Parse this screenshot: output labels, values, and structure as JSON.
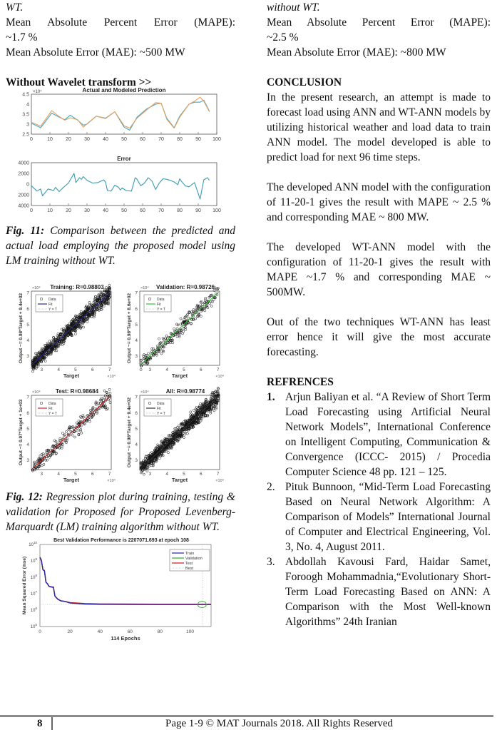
{
  "left": {
    "intro_tail": "WT.",
    "mape_line": "Mean Absolute Percent Error (MAPE):",
    "mape_value": "~1.7 %",
    "mae_line": "Mean Absolute Error (MAE): ~500 MW",
    "section_heading": "Without Wavelet transform >>",
    "fig11": {
      "label": "Fig. 11:",
      "text": " Comparison between the predicted and actual load employing the proposed model using LM training without WT."
    },
    "fig12": {
      "label": "Fig. 12:",
      "text": " Regression plot during training, testing & validation for Proposed for Proposed Levenberg-Marquardt (LM) training algorithm without WT."
    }
  },
  "right": {
    "intro_tail": "without WT.",
    "mape_line": "Mean Absolute Percent Error (MAPE):",
    "mape_value": "~2.5 %",
    "mae_line": "Mean Absolute Error (MAE): ~800 MW",
    "conclusion_heading": "CONCLUSION",
    "paragraphs": [
      "In the present research, an attempt is made to forecast load using ANN and WT-ANN models by utilizing historical weather and load data to train ANN model. The model developed is able to predict load for next 96 time steps.",
      "The developed ANN model with the configuration of 11-20-1 gives the result with MAPE ~ 2.5 % and corresponding MAE ~ 800 MW.",
      "The developed WT-ANN model with the configuration of 11-20-1 gives the result with MAPE ~1.7 % and corresponding MAE ~ 500MW.",
      "Out of the two techniques WT-ANN has least error hence it will give the most accurate forecasting."
    ],
    "references_heading": "REFRENCES",
    "references": [
      {
        "num": "1.",
        "text": "Arjun Baliyan et al. “A Review of Short Term Load Forecasting using Artificial Neural Network Models”, International Conference on Intelligent Computing, Communication & Convergence (ICCC- 2015) / Procedia Computer Science 48 pp. 121 – 125."
      },
      {
        "num": "2.",
        "text": "Pituk Bunnoon, “Mid-Term Load Forecasting Based on Neural Network Algorithm: A Comparison of Models” International Journal of Computer and Electrical Engineering, Vol. 3, No. 4, August 2011."
      },
      {
        "num": "3.",
        "text": "Abdollah Kavousi Fard, Haidar Samet, Foroogh Mohammadnia,“Evolutionary Short-Term Load Forecasting Based on ANN: A Comparison with the Most Well-known Algorithms” 24th Iranian"
      }
    ]
  },
  "footer": {
    "page_number": "8",
    "copyright": "Page 1-9 © MAT Journals 2018. All Rights Reserved"
  },
  "chart_data": [
    {
      "type": "line",
      "title": "Actual and Modeled Prediction",
      "exponent_label": "×10⁴",
      "xlim": [
        0,
        100
      ],
      "ylim": [
        2.5,
        4.5
      ],
      "xticks": [
        0,
        10,
        20,
        30,
        40,
        50,
        60,
        70,
        80,
        90,
        100
      ],
      "yticks": [
        2.5,
        3,
        3.5,
        4,
        4.5
      ],
      "x": [
        0,
        5,
        11,
        15,
        18,
        21,
        25,
        28,
        30,
        35,
        40,
        45,
        50,
        53,
        57,
        62,
        67,
        70,
        73,
        77,
        80,
        85,
        88,
        91,
        93,
        96
      ],
      "series": [
        {
          "name": "Actual",
          "color": "#3ea6c9",
          "values": [
            3.05,
            2.82,
            3.55,
            3.35,
            3.22,
            3.45,
            3.2,
            2.95,
            3.0,
            3.4,
            3.3,
            3.62,
            2.85,
            2.7,
            3.35,
            3.75,
            4.0,
            4.05,
            3.3,
            2.82,
            3.4,
            4.0,
            4.1,
            4.1,
            4.2,
            3.65
          ]
        },
        {
          "name": "Modeled",
          "color": "#e8a05a",
          "values": [
            3.1,
            2.9,
            3.68,
            3.38,
            3.2,
            3.32,
            3.22,
            2.85,
            3.02,
            3.4,
            3.28,
            3.62,
            2.92,
            2.8,
            3.3,
            3.7,
            4.08,
            4.05,
            3.25,
            2.8,
            3.35,
            4.0,
            4.15,
            4.35,
            4.15,
            3.62
          ]
        }
      ]
    },
    {
      "type": "line",
      "title": "Error",
      "xlim": [
        0,
        100
      ],
      "ylim": [
        -4000,
        4000
      ],
      "xticks": [
        0,
        10,
        20,
        30,
        40,
        50,
        60,
        70,
        80,
        90,
        100
      ],
      "yticks": [
        4000,
        2000,
        0,
        -2000,
        -4000
      ],
      "ytick_labels": [
        "4000",
        "2000",
        "0",
        "2000",
        "4000"
      ],
      "x": [
        0,
        3,
        5,
        6,
        9,
        12,
        13,
        15,
        17,
        20,
        23,
        24,
        26,
        27,
        28,
        30,
        33,
        36,
        39,
        40,
        41,
        43,
        45,
        47,
        48,
        49,
        51,
        54,
        56,
        57,
        59,
        61,
        63,
        65,
        67,
        69,
        71,
        73,
        75,
        77,
        79,
        80,
        81,
        83,
        85,
        88,
        91,
        93,
        95,
        96
      ],
      "series": [
        {
          "name": "Error",
          "color": "#3a9cb0",
          "values": [
            -300,
            -1300,
            -900,
            -2200,
            -900,
            -1200,
            -600,
            -1400,
            -700,
            200,
            2000,
            300,
            1200,
            900,
            1400,
            700,
            200,
            300,
            800,
            400,
            -1200,
            -1300,
            -200,
            -600,
            -1100,
            -700,
            -1200,
            -1300,
            1200,
            900,
            -300,
            200,
            1200,
            600,
            -1000,
            200,
            1000,
            900,
            700,
            400,
            -100,
            1000,
            500,
            -300,
            -500,
            300,
            -2800,
            800,
            1200,
            700
          ]
        }
      ]
    },
    {
      "type": "scatter",
      "panels": [
        {
          "title": "Training: R=0.98803",
          "ylabel": "Output ~= 0.98*Target + 9.4e+02",
          "fit_color": "#2b2b8c"
        },
        {
          "title": "Validation: R=0.98726",
          "ylabel": "Output ~= 0.98*Target + 8.6e+02",
          "fit_color": "#2fc42f"
        },
        {
          "title": "Test: R=0.98684",
          "ylabel": "Output ~= 0.97*Target + 1e+03",
          "fit_color": "#d42020"
        },
        {
          "title": "All: R=0.98774",
          "ylabel": "Output ~= 0.98*Target + 9.4e+02",
          "fit_color": "#333333"
        }
      ],
      "xlabel": "Target",
      "axis_exponent": "×10⁴",
      "xlim": [
        2.4,
        7.1
      ],
      "ylim": [
        2.4,
        7.1
      ],
      "xticks": [
        3,
        4,
        5,
        6,
        7
      ],
      "yticks": [
        3,
        4,
        5,
        6,
        7
      ],
      "legend": [
        "Data",
        "Fit",
        "Y = T"
      ]
    },
    {
      "type": "line",
      "title": "Best Validation Performance is 2207071.693 at epoch 108",
      "xlabel": "114 Epochs",
      "ylabel": "Mean Squared Error (mse)",
      "yscale": "log",
      "xlim": [
        0,
        114
      ],
      "ylim": [
        100000,
        10000000000
      ],
      "xticks": [
        0,
        20,
        40,
        60,
        80,
        100
      ],
      "ytick_exponents": [
        5,
        6,
        7,
        8,
        9,
        10
      ],
      "legend": [
        "Train",
        "Validation",
        "Test",
        "Best"
      ],
      "best_epoch": 108,
      "best_value": 2207071.693,
      "x": [
        0,
        1,
        2,
        3,
        4,
        5,
        6,
        7,
        8,
        9,
        10,
        12,
        14,
        17,
        20,
        25,
        30,
        40,
        60,
        80,
        100,
        108,
        114
      ],
      "series": [
        {
          "name": "Train",
          "color": "#2a2aa8",
          "values": [
            1600000000.0,
            1000000000.0,
            280000000.0,
            250000000.0,
            50000000.0,
            40000000.0,
            28000000.0,
            26000000.0,
            25000000.0,
            24000000.0,
            7000000.0,
            4500000.0,
            3600000.0,
            3300000.0,
            2700000.0,
            2500000.0,
            2350000.0,
            2250000.0,
            2200000.0,
            2200000.0,
            2200000.0,
            2200000.0,
            2200000.0
          ]
        },
        {
          "name": "Validation",
          "color": "#2fb82f",
          "values": [
            1700000000.0,
            1100000000.0,
            290000000.0,
            260000000.0,
            52000000.0,
            41000000.0,
            29000000.0,
            27000000.0,
            26000000.0,
            26000000.0,
            7200000.0,
            4600000.0,
            3700000.0,
            3400000.0,
            2800000.0,
            2600000.0,
            2400000.0,
            2300000.0,
            2250000.0,
            2220000.0,
            2210000.0,
            2207000.0,
            2210000.0
          ]
        },
        {
          "name": "Test",
          "color": "#d42020",
          "values": [
            1700000000.0,
            1100000000.0,
            290000000.0,
            260000000.0,
            51000000.0,
            41000000.0,
            29000000.0,
            27000000.0,
            26000000.0,
            25000000.0,
            7100000.0,
            4600000.0,
            3700000.0,
            3400000.0,
            2900000.0,
            2700000.0,
            2500000.0,
            2400000.0,
            2350000.0,
            2300000.0,
            2300000.0,
            2300000.0,
            2300000.0
          ]
        }
      ]
    }
  ]
}
